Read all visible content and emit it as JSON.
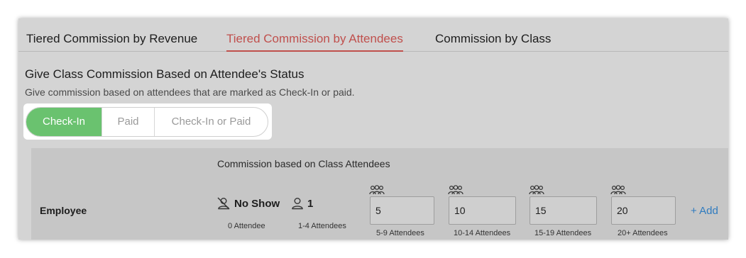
{
  "tabs": [
    {
      "label": "Tiered Commission by Revenue"
    },
    {
      "label": "Tiered Commission by Attendees"
    },
    {
      "label": "Commission by Class"
    }
  ],
  "active_tab": "Tiered Commission by Attendees",
  "section": {
    "title": "Give Class Commission Based on Attendee's Status",
    "description": "Give commission based on attendees that are marked as Check-In or paid."
  },
  "status_toggle": {
    "options": [
      "Check-In",
      "Paid",
      "Check-In or Paid"
    ],
    "selected": "Check-In"
  },
  "commission_table": {
    "title": "Commission based on Class Attendees",
    "row_label": "Employee",
    "no_show": {
      "label": "No Show",
      "sub": "0 Attendee",
      "icon": "user-slash-icon"
    },
    "single": {
      "label": "1",
      "sub": "1-4 Attendees",
      "icon": "user-icon"
    },
    "tiers": [
      {
        "value": "5",
        "sub": "5-9 Attendees",
        "icon": "users-group-icon"
      },
      {
        "value": "10",
        "sub": "10-14 Attendees",
        "icon": "users-group-icon"
      },
      {
        "value": "15",
        "sub": "15-19 Attendees",
        "icon": "users-group-icon"
      },
      {
        "value": "20",
        "sub": "20+ Attendees",
        "icon": "users-group-icon"
      }
    ],
    "add_label": "+ Add"
  },
  "colors": {
    "active_tab": "#c0504d",
    "toggle_active": "#6ac26f",
    "link": "#2f7bbf"
  }
}
